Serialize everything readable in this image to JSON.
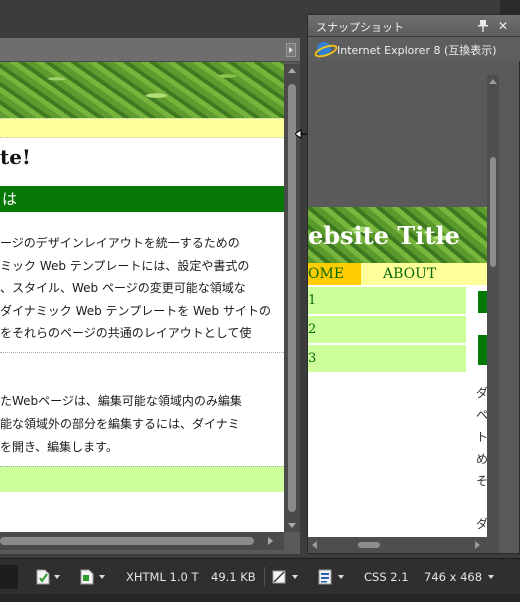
{
  "document": {
    "title_partial": "te!",
    "heading_partial": "は",
    "paragraph1": [
      "ージのデザインレイアウトを統一するための",
      "ミック Web テンプレートには、設定や書式の",
      "、スタイル、Web ページの変更可能な領域な",
      "ダイナミック Web テンプレートを Web サイトの",
      "をそれらのページの共通のレイアウトとして使"
    ],
    "paragraph2": [
      "たWebページは、編集可能な領域内のみ編集",
      "能な領域外の部分を編集するには、ダイナミ",
      "を開き、編集します。"
    ]
  },
  "snapshot_panel": {
    "tab_label": "スナップショット",
    "browser": "Internet Explorer 8 (互換表示)",
    "pin_icon": "pin-icon",
    "close_icon": "close-icon",
    "preview": {
      "site_title_partial": "ebsite Title",
      "nav": {
        "home_partial": "OME",
        "about": "ABOUT"
      },
      "side_items": [
        "1",
        "2",
        "3"
      ],
      "text_fragments": [
        "ダ",
        "ペ",
        "ト",
        "め",
        "そ",
        "ダ"
      ]
    }
  },
  "statusbar": {
    "doctype": "XHTML 1.0 T",
    "page_size": "49.1 KB",
    "css_level": "CSS 2.1",
    "resolution": "746 x 468"
  },
  "colors": {
    "banner_green": "#5d9b2e",
    "heading_green": "#067806",
    "band_yellow": "#ffff99",
    "nav_home": "#ffcc00",
    "side_green": "#ccff99",
    "link_green": "#0a6b0a"
  }
}
